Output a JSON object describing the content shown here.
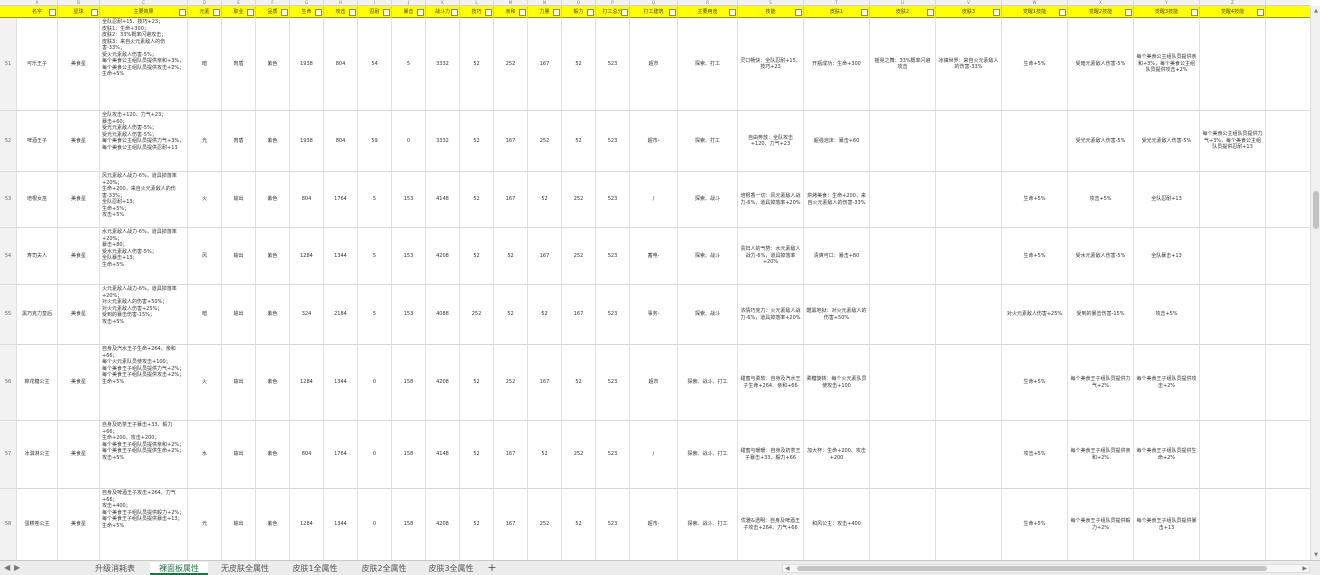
{
  "column_letters": [
    "A",
    "B",
    "C",
    "D",
    "E",
    "F",
    "G",
    "H",
    "I",
    "J",
    "K",
    "L",
    "M",
    "N",
    "O",
    "P",
    "Q",
    "R",
    "S",
    "T",
    "U",
    "V",
    "W",
    "X",
    "Y",
    "Z"
  ],
  "headers": [
    "名字",
    "星球",
    "主要效果",
    "元素",
    "职业",
    "品质",
    "生命",
    "攻击",
    "忍耐",
    "暴击",
    "战斗力",
    "技巧",
    "亲和",
    "力量",
    "毅力",
    "打工总分",
    "打工建筑",
    "主要用途",
    "技能",
    "皮肤1",
    "皮肤2",
    "皮肤3",
    "觉醒1技能",
    "觉醒2技能",
    "觉醒3技能",
    "觉醒4技能"
  ],
  "rows": [
    {
      "num": "51",
      "cells": [
        "可乐王子",
        "美食星",
        "全队忍耐+15、技巧+23；\n皮肤1：生命+300；\n皮肤2：33%概率闪避攻击；\n皮肤3：来自火元素敌人的伤害-33%；\n受火元素敌人伤害-5%；\n每个美食公主组队员提供亲和+3%，每个美食公主组队员提供攻击+2%；\n生命+5%",
        "暗",
        "肉盾",
        "紫色",
        "1938",
        "804",
        "54",
        "5",
        "3332",
        "52",
        "252",
        "167",
        "52",
        "523",
        "超市",
        "探索、打工",
        "灵口畅快：全队忍耐+15、技巧+23",
        "开瓶成功：生命+300",
        "摇晃之舞：33%概率闪避攻击",
        "冰镇世界：来自火元素敌人的伤害-33%",
        "生命+5%",
        "受暗元素敌人伤害-5%",
        "每个美食公主组队员提供亲和+3%，每个美食公主组队员提供攻击+2%",
        ""
      ]
    },
    {
      "num": "52",
      "cells": [
        "啤酒王子",
        "美食星",
        "全队攻击+120、力气+23；\n暴击+60；\n受光元素敌人伤害-5%；\n受光元素敌人伤害-5%；\n每个美食公主组队员提供力气+3%，每个美食公主组队员提供忍耐+13",
        "光",
        "肉盾",
        "紫色",
        "1938",
        "804",
        "59",
        "0",
        "3332",
        "52",
        "167",
        "252",
        "52",
        "523",
        "超市-",
        "探索、打工",
        "自由奔放：全队攻击+120、力气+23",
        "超强泡沫：暴击+60",
        "",
        "",
        "",
        "受光元素敌人伤害-5%",
        "受光元素敌人伤害-5%",
        "每个美食公主组队员提供力气+3%，每个美食公主组队员提供忍耐+13"
      ]
    },
    {
      "num": "53",
      "cells": [
        "培根女巫",
        "美食星",
        "风元素敌人战力-6%，道具掉落率+20%；\n生命+200，来自火元素敌人的伤害-33%；\n全队忍耐+13；\n生命+5%；\n攻击+5%",
        "火",
        "输出",
        "紫色",
        "804",
        "1764",
        "5",
        "153",
        "4148",
        "52",
        "167",
        "52",
        "252",
        "523",
        "/",
        "探索、战斗",
        "培根香一切：风元素敌人战力-6%，道具掉落率+20%",
        "烘烤美食：生命+200，来自火元素敌人的伤害-33%",
        "",
        "",
        "生命+5%",
        "攻击+5%",
        "全队忍耐+13",
        ""
      ]
    },
    {
      "num": "54",
      "cells": [
        "寿司夫人",
        "美食星",
        "水元素敌人战力-6%，道具掉落率+20%；\n暴击+80；\n受水元素敌人伤害-5%；\n全队暴击+13；\n生命+5%",
        "风",
        "输出",
        "紫色",
        "1284",
        "1344",
        "5",
        "153",
        "4208",
        "52",
        "52",
        "167",
        "252",
        "523",
        "蓄电-",
        "探索、战斗",
        "贵妇人的气势：水元素敌人战力-6%，道具掉落率+20%",
        "清爽可口：暴击+80",
        "",
        "",
        "生命+5%",
        "受水元素敌人伤害-5%",
        "全队暴击+13",
        ""
      ]
    },
    {
      "num": "55",
      "cells": [
        "黑巧克力皇后",
        "美食星",
        "火元素敌人战力-6%，道具掉落率+20%；\n对火元素敌人的伤害+50%；\n对火元素敌人伤害+25%；\n受到的暴击伤害-15%；\n攻击+5%",
        "暗",
        "输出",
        "紫色",
        "324",
        "2184",
        "5",
        "153",
        "4088",
        "252",
        "52",
        "52",
        "167",
        "523",
        "事务-",
        "探索、战斗",
        "浓情巧克力：火元素敌人战力-6%，道具掉落率+20%",
        "酷黑地狱：对火元素敌人的伤害+50%",
        "",
        "",
        "对火元素敌人伤害+25%",
        "受到的暴击伤害-15%",
        "攻击+5%",
        ""
      ]
    },
    {
      "num": "56",
      "cells": [
        "棉花糖公主",
        "美食星",
        "自身及汽水王子生命+264、亲和+66；\n每个火元素队员使攻击+100；\n每个美食王子组队员提供力气+2%；\n每个美食王子组队员提供攻击+2%；\n生命+5%",
        "火",
        "输出",
        "紫色",
        "1284",
        "1344",
        "0",
        "158",
        "4208",
        "52",
        "252",
        "167",
        "52",
        "523",
        "超市",
        "探索、战斗、打工",
        "甜蜜与柔软：自身及汽水王子生命+264、亲和+66",
        "柔糖旋转：每个火元素队员使攻击+100",
        "",
        "",
        "生命+5%",
        "每个美食王子组队员提供力气+2%",
        "每个美食王子组队员提供攻击+2%",
        ""
      ]
    },
    {
      "num": "57",
      "cells": [
        "冰淇淋公主",
        "美食星",
        "自身及奶茶王子暴击+33、毅力+66；\n生命+200、攻击+200；\n每个美食王子组队员提供亲和+2%；\n每个美食王子组队员提供生命+2%；\n攻击+5%",
        "水",
        "输出",
        "紫色",
        "804",
        "1764",
        "0",
        "158",
        "4148",
        "52",
        "167",
        "52",
        "252",
        "523",
        "/",
        "探索、战斗、打工",
        "甜蜜与暖暖：自身及奶茶王子暴击+33、毅力+66",
        "加大杯：生命+200、攻击+200",
        "",
        "",
        "攻击+5%",
        "每个美食王子组队员提供亲和+2%",
        "每个美食王子组队员提供生命+2%",
        ""
      ]
    },
    {
      "num": "58",
      "cells": [
        "蛋糕卷公主",
        "美食星",
        "自身及啤酒王子攻击+264、力气+66；\n攻击+400；\n每个美食王子组队员提供毅力+2%；\n每个美食王子组队员提供暴击+13；\n生命+5%",
        "光",
        "输出",
        "紫色",
        "1284",
        "1344",
        "0",
        "158",
        "4208",
        "52",
        "167",
        "252",
        "52",
        "523",
        "超市-",
        "探索、战斗、打工",
        "优雅&透明：自身及啤酒王子攻击+264、力气+66",
        "和风公主：攻击+400",
        "",
        "",
        "生命+5%",
        "每个美食王子组队员提供毅力+2%",
        "每个美食王子组队员提供暴击+13",
        ""
      ]
    }
  ],
  "tabs": [
    {
      "label": "升级消耗表",
      "active": false
    },
    {
      "label": "裸面板属性",
      "active": true
    },
    {
      "label": "无皮肤全属性",
      "active": false
    },
    {
      "label": "皮肤1全属性",
      "active": false
    },
    {
      "label": "皮肤2全属性",
      "active": false
    },
    {
      "label": "皮肤3全属性",
      "active": false
    }
  ],
  "add_sheet_symbol": "+",
  "nav": {
    "prev": "◀",
    "next": "▶"
  },
  "scroll": {
    "left": "◀",
    "right": "▶",
    "up": "▲",
    "down": "▼"
  }
}
